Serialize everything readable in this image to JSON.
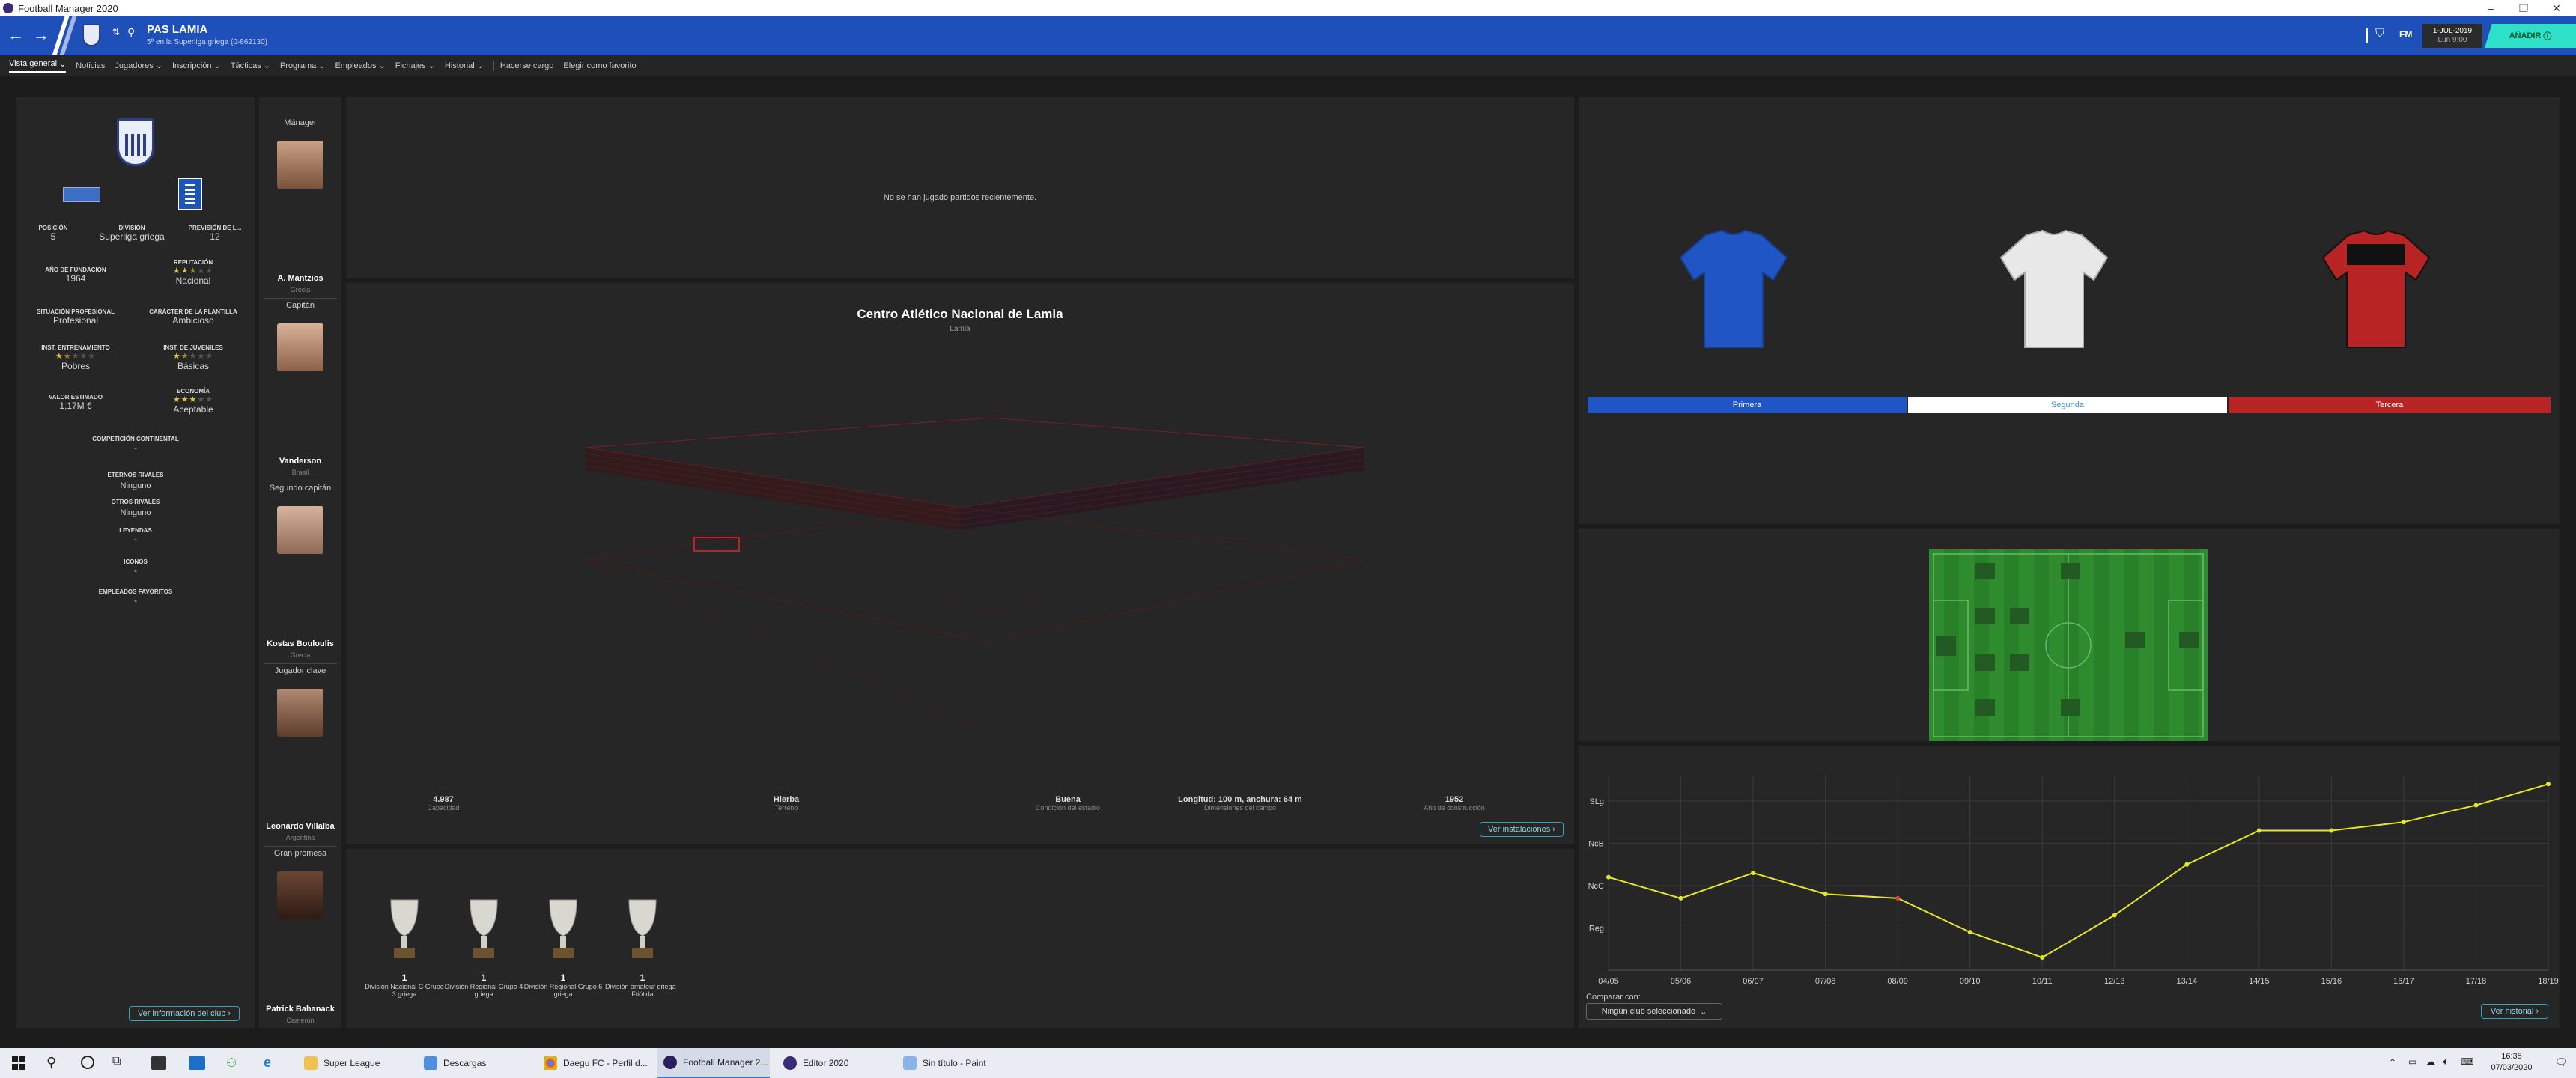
{
  "window": {
    "title": "Football Manager 2020"
  },
  "header": {
    "club_name": "PAS LAMIA",
    "club_subtitle": "5º en la Superliga griega (0-862130)",
    "date_line1": "1-JUL-2019",
    "date_line2": "Lun 9:00",
    "continue_label": "AÑADIR",
    "fm_label": "FM"
  },
  "menu": {
    "items": [
      "Vista general",
      "Noticias",
      "Jugadores",
      "Inscripción",
      "Tácticas",
      "Programa",
      "Empleados",
      "Fichajes",
      "Historial",
      "Hacerse cargo",
      "Elegir como favorito"
    ]
  },
  "club_info": {
    "position_label": "POSICIÓN",
    "position_value": "5",
    "division_label": "DIVISIÓN",
    "division_value": "Superliga griega",
    "prevision_label": "PREVISIÓN DE L...",
    "prevision_value": "12",
    "founded_label": "AÑO DE FUNDACIÓN",
    "founded_value": "1964",
    "reputation_label": "REPUTACIÓN",
    "reputation_value": "Nacional",
    "reputation_stars": 2.5,
    "professional_label": "SITUACIÓN PROFESIONAL",
    "professional_value": "Profesional",
    "squad_label": "CARÁCTER DE LA PLANTILLA",
    "squad_value": "Ambicioso",
    "training_label": "INST. ENTRENAMIENTO",
    "training_value": "Pobres",
    "training_stars": 1.5,
    "youth_label": "INST. DE JUVENILES",
    "youth_value": "Básicas",
    "youth_stars": 1.5,
    "value_label": "VALOR ESTIMADO",
    "value_value": "1,17M €",
    "economy_label": "ECONOMÍA",
    "economy_value": "Aceptable",
    "economy_stars": 3,
    "continental_label": "COMPETICIÓN CONTINENTAL",
    "continental_value": "-",
    "rivals_label": "ETERNOS RIVALES",
    "rivals_value": "Ninguno",
    "other_rivals_label": "OTROS RIVALES",
    "other_rivals_value": "Ninguno",
    "legends_label": "LEYENDAS",
    "legends_value": "-",
    "icons_label": "ICONOS",
    "icons_value": "-",
    "fav_staff_label": "EMPLEADOS FAVORITOS",
    "fav_staff_value": "-",
    "button": "Ver información del club"
  },
  "staff": [
    {
      "title": "Mánager",
      "name": "A. Mantzios",
      "nat": "Grecia"
    },
    {
      "title": "Capitán",
      "name": "Vanderson",
      "nat": "Brasil"
    },
    {
      "title": "Segundo capitán",
      "name": "Kostas Bouloulis",
      "nat": "Grecia"
    },
    {
      "title": "Jugador clave",
      "name": "Leonardo Villalba",
      "nat": "Argentina"
    },
    {
      "title": "Gran promesa",
      "name": "Patrick Bahanack",
      "nat": "Camerún"
    }
  ],
  "recent": {
    "empty_text": "No se han jugado partidos recientemente."
  },
  "stadium": {
    "name": "Centro Atlético Nacional de Lamia",
    "city": "Lamia",
    "stats": [
      {
        "value": "4.987",
        "label": "Capacidad"
      },
      {
        "value": "Hierba",
        "label": "Terreno"
      },
      {
        "value": "Buena",
        "label": "Condición del estadio"
      },
      {
        "value": "Longitud: 100 m, anchura: 64 m",
        "label": "Dimensiones del campo"
      },
      {
        "value": "1952",
        "label": "Año de construcción"
      }
    ],
    "button": "Ver instalaciones"
  },
  "trophies": [
    {
      "count": "1",
      "name": "División Nacional C Grupo 3 griega"
    },
    {
      "count": "1",
      "name": "División Regional Grupo 4 griega"
    },
    {
      "count": "1",
      "name": "División Regional Grupo 6 griega"
    },
    {
      "count": "1",
      "name": "División amateur griega - Ftiótida"
    }
  ],
  "kits": [
    {
      "label": "Primera",
      "color": "#1f55c4",
      "text": "#ffffff"
    },
    {
      "label": "Segunda",
      "color": "#ffffff",
      "text": "#3a8fd4"
    },
    {
      "label": "Tercera",
      "color": "#b82424",
      "text": "#ffffff"
    }
  ],
  "history_chart": {
    "compare_label": "Comparar con:",
    "compare_value": "Ningún club seleccionado",
    "button": "Ver historial"
  },
  "chart_data": {
    "type": "line",
    "categories": [
      "04/05",
      "05/06",
      "06/07",
      "07/08",
      "08/09",
      "09/10",
      "10/11",
      "12/13",
      "13/14",
      "14/15",
      "15/16",
      "16/17",
      "17/18",
      "18/19"
    ],
    "y_levels": [
      "SLg",
      "NcB",
      "NcC",
      "Reg"
    ],
    "series": [
      {
        "values": [
          2.2,
          1.7,
          2.3,
          1.8,
          1.7,
          0.9,
          0.3,
          1.3,
          2.5,
          3.3,
          3.3,
          3.5,
          3.9,
          4.4
        ]
      }
    ],
    "ylim": [
      0,
      4.6
    ],
    "line_color": "#e6e62a",
    "grid": true
  },
  "taskbar": {
    "items": [
      "Super League",
      "Descargas",
      "Daegu FC - Perfil d...",
      "Football Manager 2...",
      "Editor 2020",
      "Sin título - Paint"
    ],
    "time": "16:35",
    "date": "07/03/2020"
  }
}
